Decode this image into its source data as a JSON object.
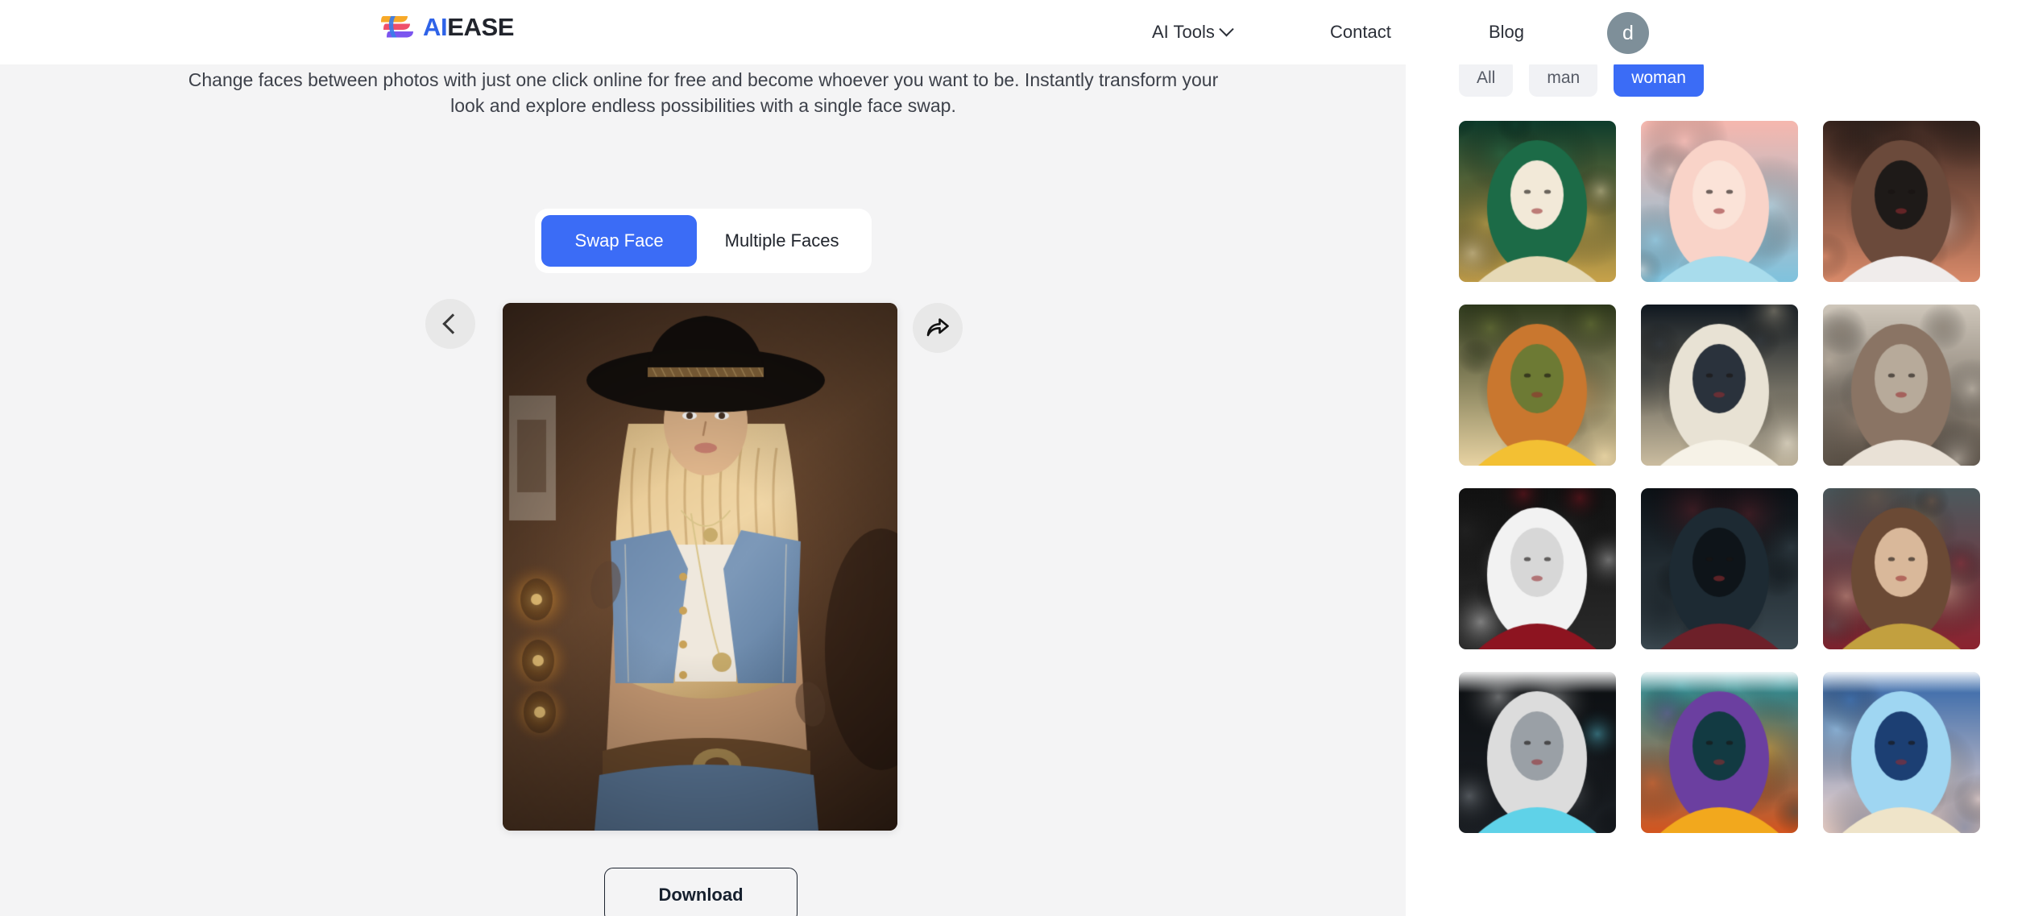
{
  "header": {
    "logo": {
      "mark_icon": "aiease-wing-logo-icon",
      "text_primary": "AI",
      "text_secondary": "EASE",
      "colors": {
        "ai_blue": "#2f63e8",
        "ease_dark": "#21242c",
        "mark_orange": "#f7a928",
        "mark_pink": "#ef4f6b",
        "mark_purple": "#7b55ef"
      }
    },
    "nav": [
      {
        "label": "AI Tools",
        "has_dropdown": true,
        "icon": "chevron-down-icon"
      },
      {
        "label": "Contact",
        "has_dropdown": false
      },
      {
        "label": "Blog",
        "has_dropdown": false
      }
    ],
    "avatar": {
      "initial": "d",
      "color": "#7e8f99"
    }
  },
  "main": {
    "subtitle": "Change faces between photos with just one click online for free and become whoever you want to be. Instantly transform your look and explore endless possibilities with a single face swap.",
    "tabs": [
      {
        "label": "Swap Face",
        "active": true
      },
      {
        "label": "Multiple Faces",
        "active": false
      }
    ],
    "active_tab_color": "#3b6cf6",
    "controls": {
      "prev_icon": "chevron-left-icon",
      "share_icon": "share-arrow-icon"
    },
    "preview": {
      "alt": "Swapped result: blonde woman wearing a black cowboy hat, denim vest and white crop top in a warm lamp-lit interior"
    },
    "download_label": "Download"
  },
  "gallery": {
    "filters": [
      {
        "label": "All",
        "active": false
      },
      {
        "label": "man",
        "active": false
      },
      {
        "label": "woman",
        "active": true
      }
    ],
    "active_filter_color": "#3b6cf6",
    "thumbnails": [
      {
        "name": "victorian-green-dress-woman",
        "palette": [
          "#0d3c2c",
          "#1c6b47",
          "#e6d9b6",
          "#c8a24a",
          "#f2e9d8"
        ]
      },
      {
        "name": "pink-hair-fantasy-woman",
        "palette": [
          "#f6b7ae",
          "#f9d3c8",
          "#a8dcec",
          "#7fc3de",
          "#fbe3d8"
        ]
      },
      {
        "name": "brunette-white-shirt-woman",
        "palette": [
          "#3a2620",
          "#6b4a3b",
          "#f0eceb",
          "#d98a6a",
          "#1e1a18"
        ]
      },
      {
        "name": "straw-hat-sunflower-woman",
        "palette": [
          "#2f3a1d",
          "#c9772f",
          "#f3c033",
          "#e8d3a3",
          "#6d7a34"
        ]
      },
      {
        "name": "flower-crown-blonde-woman",
        "palette": [
          "#101820",
          "#e8e2d4",
          "#f6f2e7",
          "#cbbda0",
          "#2a323c"
        ]
      },
      {
        "name": "street-portrait-woman",
        "palette": [
          "#cfc7bb",
          "#8a7464",
          "#e9e1d6",
          "#5d5348",
          "#b7aa9a"
        ]
      },
      {
        "name": "gothic-black-white-hair-woman",
        "palette": [
          "#121212",
          "#f2f2f2",
          "#8d1420",
          "#2a2a2a",
          "#d7d7d7"
        ]
      },
      {
        "name": "dark-vampire-woman",
        "palette": [
          "#0b1116",
          "#1d2a33",
          "#6d2029",
          "#3c4a52",
          "#0e1419"
        ]
      },
      {
        "name": "wonder-woman-heroine",
        "palette": [
          "#4c5a5e",
          "#6b4a35",
          "#c2a03f",
          "#8c2330",
          "#d9b89a"
        ]
      },
      {
        "name": "dark-witch-staff-woman",
        "partial": true,
        "palette": [
          "#0c0f12",
          "#dcdcdc",
          "#5fd2e8",
          "#1b1f24",
          "#9aa0a6"
        ]
      },
      {
        "name": "cartoon-purple-witch",
        "partial": true,
        "palette": [
          "#2f9aa3",
          "#6b3fa0",
          "#f2a81d",
          "#d4551f",
          "#123a42"
        ]
      },
      {
        "name": "ice-princess-tiara-woman",
        "partial": true,
        "palette": [
          "#2d63a8",
          "#9fd6f2",
          "#efe4c9",
          "#f5d9cf",
          "#1c3f73"
        ]
      }
    ]
  }
}
